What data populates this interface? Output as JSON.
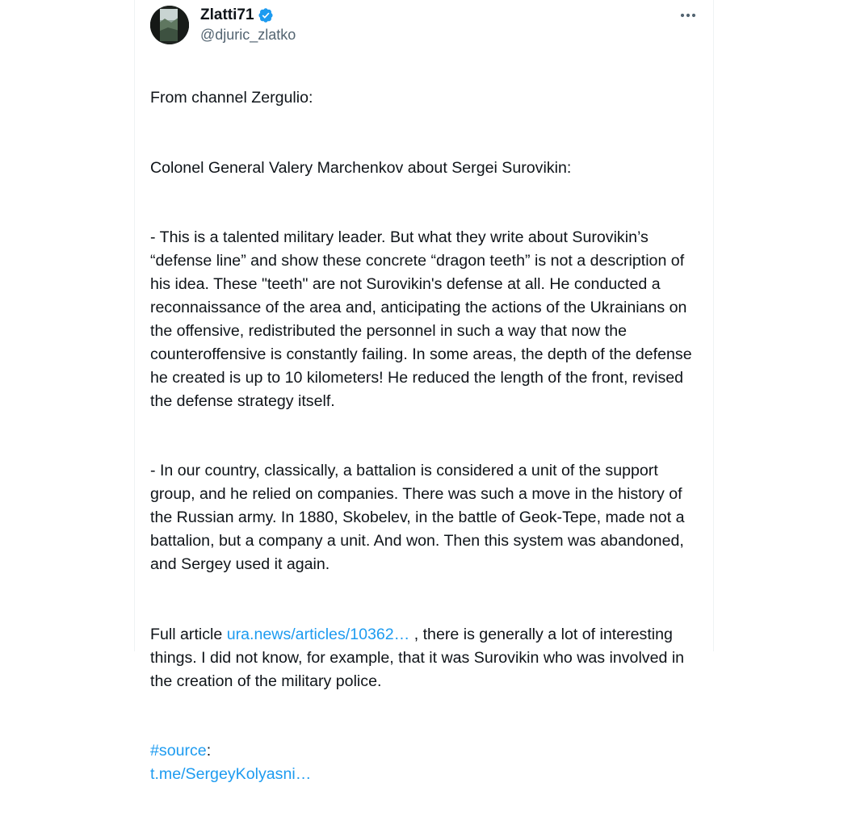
{
  "tweet": {
    "author": {
      "display_name": "Zlatti71",
      "handle": "@djuric_zlatko",
      "verified": true,
      "avatar_icon": "landscape-avatar-photo"
    },
    "more_icon": "more-horizontal-icon",
    "paragraphs": [
      "From channel Zergulio:",
      "Colonel General Valery Marchenkov about Sergei Surovikin:",
      "- This is a talented military leader. But what they write about Surovikin’s “defense line” and show these concrete “dragon teeth” is not a description of his idea. These \"teeth\" are not Surovikin's defense at all. He conducted a reconnaissance of the area and, anticipating the actions of the Ukrainians on the offensive, redistributed the personnel in such a way that now the counteroffensive is constantly failing. In some areas, the depth of the defense he created is up to 10 kilometers! He reduced the length of the front, revised the defense strategy itself.",
      "- In our country, classically, a battalion is considered a unit of the support group, and he relied on companies. There was such a move in the history of the Russian army. In 1880, Skobelev, in the battle of Geok-Tepe, made not a battalion, but a company a unit. And won. Then this system was abandoned, and Sergey used it again."
    ],
    "article": {
      "prefix": "Full article ",
      "link_text": "ura.news/articles/10362…",
      "suffix": " , there is generally a lot of interesting things. I did not know, for example, that it was Surovikin who was involved in the creation of the military police."
    },
    "source": {
      "hashtag": "#source",
      "colon": ":",
      "link_text": "t.me/SergeyKolyasni…"
    }
  },
  "colors": {
    "text": "#0f1419",
    "secondary": "#536471",
    "link": "#1d9bf0"
  }
}
